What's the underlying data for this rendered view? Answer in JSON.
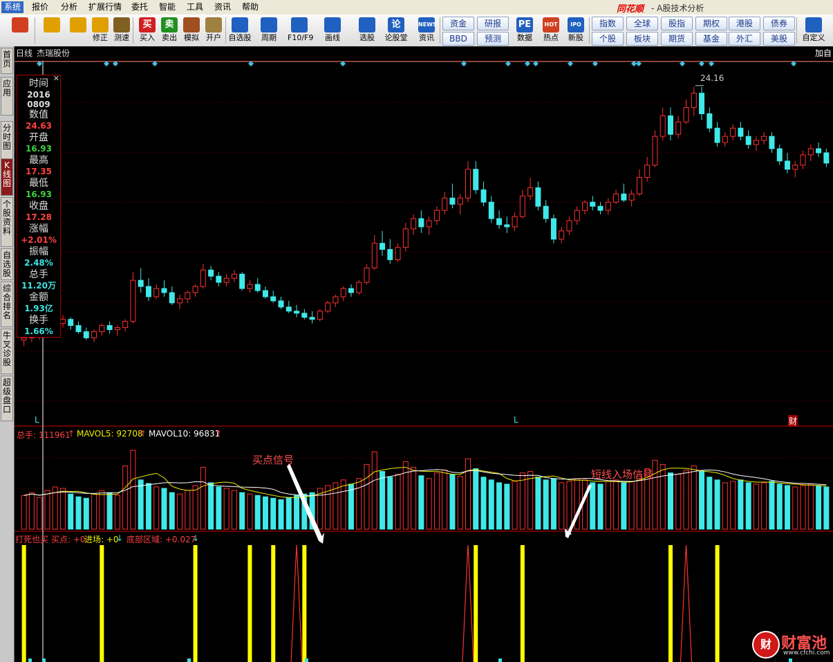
{
  "menu": [
    "系统",
    "报价",
    "分析",
    "扩展行情",
    "委托",
    "智能",
    "工具",
    "资讯",
    "帮助"
  ],
  "brand": "同花顺",
  "app_title": "- A股技术分析",
  "toolbar": [
    {
      "label": "",
      "icon": "grid-icon",
      "color": "#d04020"
    },
    {
      "label": "",
      "icon": "back-arrow-icon",
      "color": "#e0a000"
    },
    {
      "label": "",
      "icon": "up-down-arrow-icon",
      "color": "#e0a000"
    },
    {
      "label": "修正",
      "icon": "refresh-icon",
      "color": "#e0a000"
    },
    {
      "label": "测速",
      "icon": "clock-icon",
      "color": "#806020"
    },
    {
      "label": "买入",
      "icon": "buy-icon",
      "color": "#d02020",
      "glyph": "买"
    },
    {
      "label": "卖出",
      "icon": "sell-icon",
      "color": "#209020",
      "glyph": "卖"
    },
    {
      "label": "模拟",
      "icon": "hammer-icon",
      "color": "#a05020"
    },
    {
      "label": "开户",
      "icon": "lock-icon",
      "color": "#a08040"
    },
    {
      "label": "自选股",
      "icon": "star-icon",
      "color": "#2060c0"
    },
    {
      "label": "周期",
      "icon": "clock-cycle-icon",
      "color": "#2060c0"
    },
    {
      "label": "F10/F9",
      "icon": "window-icon",
      "color": "#2060c0"
    },
    {
      "label": "画线",
      "icon": "pencil-icon",
      "color": "#2060c0"
    },
    {
      "label": "选股",
      "icon": "monitor-icon",
      "color": "#2060c0"
    },
    {
      "label": "论股堂",
      "icon": "chat-icon",
      "color": "#2060c0",
      "glyph": "论"
    },
    {
      "label": "资讯",
      "icon": "news-icon",
      "color": "#2060c0",
      "glyph": "NEWS"
    },
    {
      "label": "数据",
      "icon": "pe-icon",
      "color": "#2060c0",
      "glyph": "PE"
    },
    {
      "label": "热点",
      "icon": "hot-icon",
      "color": "#d04020",
      "glyph": "HOT"
    },
    {
      "label": "新股",
      "icon": "ipo-icon",
      "color": "#2060c0",
      "glyph": "IPO"
    },
    {
      "label": "自定义",
      "icon": "customize-icon",
      "color": "#2060c0"
    }
  ],
  "quick_buttons": [
    "资金",
    "研报",
    "BBD",
    "预测",
    "指数",
    "全球",
    "股指",
    "期权",
    "港股",
    "债券",
    "个股",
    "板块",
    "期货",
    "基金",
    "外汇",
    "美股"
  ],
  "sidebar": [
    "首页",
    "应用",
    "分时图",
    "K线图",
    "个股资料",
    "自选股",
    "综合排名",
    "牛叉诊股",
    "超级盘口"
  ],
  "chart_header": {
    "period": "日线",
    "stock_name": "杰瑞股份",
    "add_button": "加自"
  },
  "info_panel": [
    {
      "key": "时间",
      "value": "2016\n0809",
      "color": "#dddddd"
    },
    {
      "key": "数值",
      "value": "24.63",
      "color": "#ff4040"
    },
    {
      "key": "开盘",
      "value": "16.93",
      "color": "#40d040"
    },
    {
      "key": "最高",
      "value": "17.35",
      "color": "#ff4040"
    },
    {
      "key": "最低",
      "value": "16.93",
      "color": "#40d040"
    },
    {
      "key": "收盘",
      "value": "17.28",
      "color": "#ff4040"
    },
    {
      "key": "涨幅",
      "value": "+2.01%",
      "color": "#ff4040"
    },
    {
      "key": "振幅",
      "value": "2.48%",
      "color": "#40e0e0"
    },
    {
      "key": "总手",
      "value": "11.20万",
      "color": "#40e0e0"
    },
    {
      "key": "金额",
      "value": "1.93亿",
      "color": "#40e0e0"
    },
    {
      "key": "换手",
      "value": "1.66%",
      "color": "#40e0e0"
    }
  ],
  "price_annotation": "24.16",
  "volume_header": {
    "total_label": "总手: 111961",
    "mavol5": "MAVOL5: 92708",
    "mavol10": "MAVOL10: 96831"
  },
  "indicator_header": {
    "name": "打死也买",
    "buy": "买点: +0",
    "entry": "进场: +0",
    "bottom": "底部区域: +0.027"
  },
  "annotations": {
    "buy_signal": "买点信号",
    "short_entry": "短线入场信号"
  },
  "markers": {
    "L1": "L",
    "L2": "L",
    "fin": "财"
  },
  "watermark": {
    "text": "财富池",
    "url": "www.cfchi.com"
  },
  "colors": {
    "up": "#ff3030",
    "down": "#40e8e8",
    "ma5": "#f0f000",
    "ma10": "#ffffff",
    "signal": "#ffff00"
  },
  "chart_data": {
    "type": "candlestick",
    "ohlc": [
      [
        16.9,
        17.2,
        16.6,
        17.0
      ],
      [
        17.0,
        17.3,
        16.8,
        17.1
      ],
      [
        17.1,
        17.4,
        16.9,
        17.3
      ],
      [
        17.3,
        17.6,
        17.0,
        17.4
      ],
      [
        17.4,
        17.8,
        17.2,
        17.7
      ],
      [
        17.7,
        18.1,
        17.5,
        17.9
      ],
      [
        17.9,
        18.0,
        17.4,
        17.6
      ],
      [
        17.6,
        17.8,
        17.2,
        17.3
      ],
      [
        17.3,
        17.5,
        16.9,
        17.0
      ],
      [
        17.0,
        17.4,
        16.8,
        17.3
      ],
      [
        17.3,
        17.7,
        17.1,
        17.6
      ],
      [
        17.6,
        17.8,
        17.2,
        17.4
      ],
      [
        17.4,
        17.6,
        17.1,
        17.5
      ],
      [
        17.5,
        17.9,
        17.3,
        17.8
      ],
      [
        17.8,
        20.2,
        17.7,
        19.8
      ],
      [
        19.8,
        20.4,
        19.2,
        19.5
      ],
      [
        19.5,
        19.9,
        18.8,
        19.0
      ],
      [
        19.0,
        19.6,
        18.9,
        19.4
      ],
      [
        19.4,
        19.8,
        19.0,
        19.2
      ],
      [
        19.2,
        19.5,
        18.6,
        18.7
      ],
      [
        18.7,
        19.1,
        18.4,
        18.9
      ],
      [
        18.9,
        19.3,
        18.7,
        19.2
      ],
      [
        19.2,
        19.6,
        19.0,
        19.5
      ],
      [
        19.5,
        20.6,
        19.4,
        20.3
      ],
      [
        20.3,
        20.5,
        19.8,
        20.0
      ],
      [
        20.0,
        20.2,
        19.5,
        19.7
      ],
      [
        19.7,
        20.1,
        19.5,
        19.9
      ],
      [
        19.9,
        20.3,
        19.7,
        20.1
      ],
      [
        20.1,
        20.2,
        19.3,
        19.4
      ],
      [
        19.4,
        19.8,
        19.2,
        19.6
      ],
      [
        19.6,
        19.9,
        19.2,
        19.3
      ],
      [
        19.3,
        19.5,
        18.9,
        19.0
      ],
      [
        19.0,
        19.3,
        18.7,
        18.8
      ],
      [
        18.8,
        19.0,
        18.4,
        18.5
      ],
      [
        18.5,
        18.8,
        18.2,
        18.3
      ],
      [
        18.3,
        18.6,
        18.0,
        18.2
      ],
      [
        18.2,
        18.4,
        17.9,
        18.0
      ],
      [
        18.0,
        18.3,
        17.7,
        17.9
      ],
      [
        17.9,
        18.4,
        17.8,
        18.3
      ],
      [
        18.3,
        18.8,
        18.2,
        18.7
      ],
      [
        18.7,
        19.1,
        18.5,
        19.0
      ],
      [
        19.0,
        19.5,
        18.8,
        19.4
      ],
      [
        19.4,
        19.6,
        19.0,
        19.2
      ],
      [
        19.2,
        19.8,
        19.1,
        19.7
      ],
      [
        19.7,
        20.6,
        19.6,
        20.4
      ],
      [
        20.4,
        22.0,
        20.3,
        21.6
      ],
      [
        21.6,
        22.2,
        21.0,
        21.3
      ],
      [
        21.3,
        21.8,
        20.6,
        20.8
      ],
      [
        20.8,
        21.6,
        20.7,
        21.4
      ],
      [
        21.4,
        22.6,
        21.2,
        22.3
      ],
      [
        22.3,
        23.0,
        22.0,
        22.8
      ],
      [
        22.8,
        23.2,
        22.1,
        22.4
      ],
      [
        22.4,
        22.9,
        22.0,
        22.7
      ],
      [
        22.7,
        23.4,
        22.5,
        23.2
      ],
      [
        23.2,
        24.1,
        23.0,
        23.8
      ],
      [
        23.8,
        24.5,
        23.3,
        23.5
      ],
      [
        23.5,
        24.0,
        23.0,
        23.8
      ],
      [
        23.8,
        25.6,
        23.6,
        25.2
      ],
      [
        25.2,
        25.6,
        24.0,
        24.2
      ],
      [
        24.2,
        24.6,
        23.4,
        23.6
      ],
      [
        23.6,
        23.9,
        22.6,
        22.8
      ],
      [
        22.8,
        23.2,
        22.3,
        22.5
      ],
      [
        22.5,
        22.9,
        22.1,
        22.4
      ],
      [
        22.4,
        23.1,
        22.2,
        22.9
      ],
      [
        22.9,
        24.2,
        22.8,
        23.9
      ],
      [
        23.9,
        24.8,
        23.7,
        24.3
      ],
      [
        24.3,
        24.6,
        23.2,
        23.4
      ],
      [
        23.4,
        23.7,
        22.6,
        22.8
      ],
      [
        22.8,
        23.0,
        21.6,
        21.8
      ],
      [
        21.8,
        22.4,
        21.6,
        22.2
      ],
      [
        22.2,
        22.9,
        22.0,
        22.7
      ],
      [
        22.7,
        23.4,
        22.5,
        23.2
      ],
      [
        23.2,
        23.7,
        23.0,
        23.6
      ],
      [
        23.6,
        23.9,
        23.2,
        23.4
      ],
      [
        23.4,
        23.6,
        23.0,
        23.2
      ],
      [
        23.2,
        23.8,
        23.0,
        23.6
      ],
      [
        23.6,
        24.2,
        23.5,
        24.0
      ],
      [
        24.0,
        24.5,
        23.6,
        23.7
      ],
      [
        23.7,
        24.2,
        23.4,
        24.0
      ],
      [
        24.0,
        25.2,
        23.9,
        24.8
      ],
      [
        24.8,
        25.8,
        24.6,
        25.4
      ],
      [
        25.4,
        27.1,
        25.3,
        26.8
      ],
      [
        26.8,
        28.2,
        26.6,
        27.8
      ],
      [
        27.8,
        28.2,
        26.6,
        26.9
      ],
      [
        26.9,
        27.8,
        26.7,
        27.5
      ],
      [
        27.5,
        28.6,
        27.4,
        28.2
      ],
      [
        28.2,
        29.2,
        27.8,
        28.9
      ],
      [
        28.9,
        29.2,
        27.6,
        27.9
      ],
      [
        27.9,
        28.2,
        27.0,
        27.2
      ],
      [
        27.2,
        27.5,
        26.3,
        26.5
      ],
      [
        26.5,
        27.0,
        26.3,
        26.8
      ],
      [
        26.8,
        27.4,
        26.6,
        27.2
      ],
      [
        27.2,
        27.5,
        26.6,
        26.8
      ],
      [
        26.8,
        27.1,
        26.2,
        26.4
      ],
      [
        26.4,
        26.8,
        26.1,
        26.6
      ],
      [
        26.6,
        27.0,
        26.4,
        26.8
      ],
      [
        26.8,
        27.0,
        26.0,
        26.2
      ],
      [
        26.2,
        26.4,
        25.4,
        25.6
      ],
      [
        25.6,
        26.0,
        25.0,
        25.2
      ],
      [
        25.2,
        25.6,
        24.8,
        25.4
      ],
      [
        25.4,
        26.1,
        25.2,
        25.9
      ],
      [
        25.9,
        26.4,
        25.6,
        26.2
      ],
      [
        26.2,
        26.5,
        25.8,
        26.0
      ],
      [
        26.0,
        26.2,
        25.3,
        25.5
      ]
    ],
    "volume": [
      48,
      52,
      45,
      55,
      60,
      58,
      50,
      46,
      44,
      50,
      55,
      52,
      48,
      90,
      112,
      70,
      65,
      60,
      58,
      52,
      50,
      55,
      62,
      88,
      66,
      60,
      58,
      55,
      52,
      50,
      48,
      46,
      44,
      42,
      45,
      48,
      50,
      52,
      58,
      62,
      66,
      70,
      64,
      72,
      92,
      110,
      82,
      74,
      78,
      96,
      88,
      76,
      72,
      80,
      84,
      78,
      75,
      100,
      86,
      74,
      70,
      66,
      64,
      68,
      80,
      82,
      74,
      70,
      72,
      66,
      68,
      72,
      70,
      66,
      64,
      68,
      70,
      66,
      68,
      78,
      86,
      98,
      92,
      80,
      78,
      84,
      90,
      82,
      74,
      70,
      66,
      68,
      70,
      66,
      64,
      66,
      68,
      64,
      62,
      60,
      62,
      64,
      62,
      60
    ],
    "signals": [
      {
        "type": "entry",
        "idx": 0
      },
      {
        "type": "entry",
        "idx": 10
      },
      {
        "type": "entry",
        "idx": 22
      },
      {
        "type": "entry",
        "idx": 29
      },
      {
        "type": "entry",
        "idx": 32
      },
      {
        "type": "buy",
        "idx": 35
      },
      {
        "type": "entry",
        "idx": 36
      },
      {
        "type": "buy",
        "idx": 57
      },
      {
        "type": "entry",
        "idx": 58
      },
      {
        "type": "entry",
        "idx": 64
      },
      {
        "type": "entry",
        "idx": 83
      },
      {
        "type": "buy",
        "idx": 85
      },
      {
        "type": "entry",
        "idx": 89
      }
    ]
  }
}
